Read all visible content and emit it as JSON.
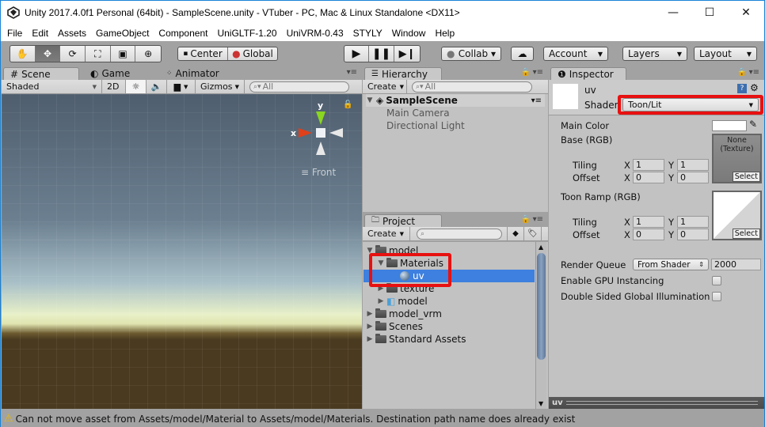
{
  "window": {
    "title": "Unity 2017.4.0f1 Personal (64bit) - SampleScene.unity - VTuber - PC, Mac & Linux Standalone <DX11>",
    "minimize_icon": "minimize-icon",
    "maximize_icon": "maximize-icon",
    "close_icon": "close-icon"
  },
  "menu": [
    "File",
    "Edit",
    "Assets",
    "GameObject",
    "Component",
    "UniGLTF-1.20",
    "UniVRM-0.43",
    "STYLY",
    "Window",
    "Help"
  ],
  "toolbar": {
    "tools": [
      "hand-tool",
      "move-tool",
      "rotate-tool",
      "scale-tool",
      "rect-tool",
      "transform-tool"
    ],
    "active_tool": "move-tool",
    "pivot_label": "Center",
    "space_label": "Global",
    "play_icons": [
      "play-icon",
      "pause-icon",
      "step-icon"
    ],
    "collab_label": "Collab ▾",
    "account_label": "Account",
    "layers_label": "Layers",
    "layout_label": "Layout"
  },
  "scene_panel": {
    "tabs": [
      "Scene",
      "Game",
      "Animator"
    ],
    "active_tab": "Scene",
    "shading_mode": "Shaded",
    "mode_2d": "2D",
    "gizmos_label": "Gizmos",
    "search_placeholder": "All",
    "gizmo": {
      "x_label": "x",
      "y_label": "y",
      "view_label": "Front"
    }
  },
  "hierarchy": {
    "tab": "Hierarchy",
    "create_label": "Create",
    "search_placeholder": "All",
    "scene_name": "SampleScene",
    "items": [
      "Main Camera",
      "Directional Light"
    ]
  },
  "project": {
    "tab": "Project",
    "create_label": "Create",
    "tree": [
      {
        "label": "model",
        "depth": 0,
        "expanded": true,
        "type": "folder"
      },
      {
        "label": "Materials",
        "depth": 1,
        "expanded": true,
        "type": "folder"
      },
      {
        "label": "uv",
        "depth": 2,
        "type": "material",
        "selected": true
      },
      {
        "label": "texture",
        "depth": 1,
        "expanded": false,
        "type": "folder"
      },
      {
        "label": "model",
        "depth": 1,
        "expanded": false,
        "type": "prefab"
      },
      {
        "label": "model_vrm",
        "depth": 0,
        "expanded": false,
        "type": "folder"
      },
      {
        "label": "Scenes",
        "depth": 0,
        "expanded": false,
        "type": "folder"
      },
      {
        "label": "Standard Assets",
        "depth": 0,
        "expanded": false,
        "type": "folder"
      }
    ]
  },
  "inspector": {
    "tab": "Inspector",
    "material_name": "uv",
    "shader_label": "Shader",
    "shader_value": "Toon/Lit",
    "main_color_label": "Main Color",
    "base_label": "Base (RGB)",
    "base_texture": "None\n(Texture)",
    "select_label": "Select",
    "tiling_label": "Tiling",
    "offset_label": "Offset",
    "x_label": "X",
    "y_label": "Y",
    "base_tiling": {
      "x": "1",
      "y": "1"
    },
    "base_offset": {
      "x": "0",
      "y": "0"
    },
    "ramp_label": "Toon Ramp (RGB)",
    "ramp_tiling": {
      "x": "1",
      "y": "1"
    },
    "ramp_offset": {
      "x": "0",
      "y": "0"
    },
    "render_queue_label": "Render Queue",
    "render_queue_mode": "From Shader",
    "render_queue_value": "2000",
    "gpu_instancing_label": "Enable GPU Instancing",
    "double_sided_gi_label": "Double Sided Global Illumination",
    "preview_label": "uv"
  },
  "status": {
    "message": "Can not move asset from Assets/model/Material to Assets/model/Materials. Destination path name does already exist"
  },
  "highlight_color": "#e81010",
  "selection_color": "#3d80df"
}
